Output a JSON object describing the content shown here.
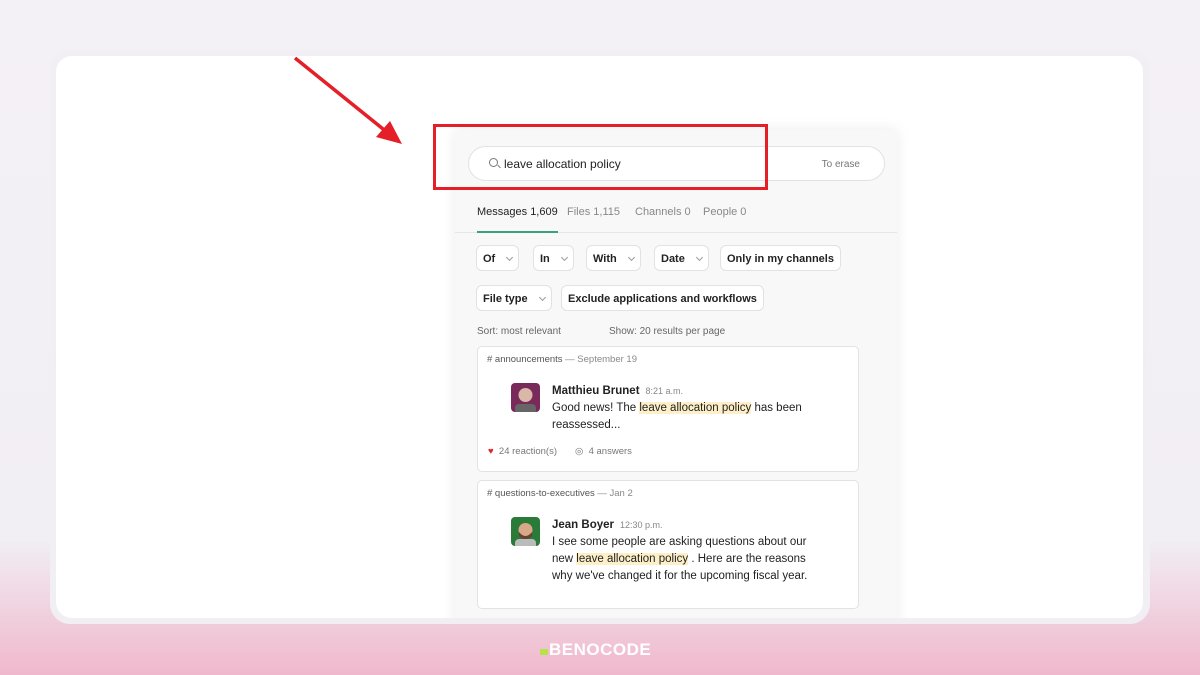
{
  "search": {
    "query": "leave allocation policy",
    "erase_label": "To erase"
  },
  "tabs": [
    {
      "label": "Messages 1,609"
    },
    {
      "label": "Files 1,115"
    },
    {
      "label": "Channels 0"
    },
    {
      "label": "People 0"
    }
  ],
  "filters": [
    {
      "label": "Of"
    },
    {
      "label": "In"
    },
    {
      "label": "With"
    },
    {
      "label": "Date"
    },
    {
      "label": "Only in my channels"
    },
    {
      "label": "File type"
    },
    {
      "label": "Exclude applications and workflows"
    }
  ],
  "sort": "Sort: most relevant",
  "show": "Show: 20 results per page",
  "results": [
    {
      "channel": "# announcements",
      "date": "— September 19",
      "author": "Matthieu Brunet",
      "time": "8:21 a.m.",
      "pre": "Good news! The ",
      "highlight": "leave allocation policy",
      "post": " has been reassessed...",
      "reactions": "24 reaction(s)",
      "answers": "4 answers"
    },
    {
      "channel": "# questions-to-executives",
      "date": "— Jan 2",
      "author": "Jean Boyer",
      "time": "12:30 p.m.",
      "pre": "I see some people are asking questions about our new ",
      "highlight": "leave allocation policy",
      "post": " . Here are the reasons why we've changed it for the upcoming fiscal year."
    }
  ],
  "brand": "BENOCODE",
  "colors": {
    "accent": "#3aa27a",
    "annotation": "#e41f27",
    "highlight": "#fdf0c8"
  }
}
